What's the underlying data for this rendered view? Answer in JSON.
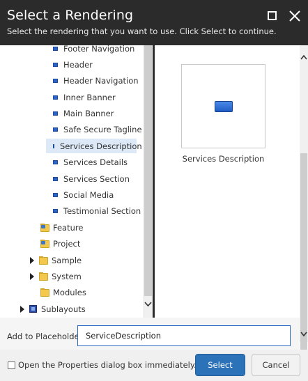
{
  "dialog": {
    "title": "Select a Rendering",
    "subtitle": "Select the rendering that you want to use. Click Select to continue."
  },
  "tree": {
    "renderings": [
      "Footer Navigation",
      "Header",
      "Header Navigation",
      "Inner Banner",
      "Main Banner",
      "Safe Secure Tagline",
      "Services Description",
      "Services Details",
      "Services Section",
      "Social Media",
      "Testimonial Section"
    ],
    "selected": "Services Description",
    "folders": [
      "Feature",
      "Project",
      "Sample",
      "System",
      "Modules"
    ],
    "sublayouts": "Sublayouts"
  },
  "preview": {
    "label": "Services Description"
  },
  "placeholder": {
    "label": "Add to Placeholder:",
    "value": "ServiceDescription"
  },
  "footer": {
    "checkbox_label": "Open the Properties dialog box immediately.",
    "select_label": "Select",
    "cancel_label": "Cancel"
  },
  "colors": {
    "titlebar": "#2b2b2b",
    "selected_row": "#dde9f7",
    "primary_button": "#2c72b8"
  }
}
